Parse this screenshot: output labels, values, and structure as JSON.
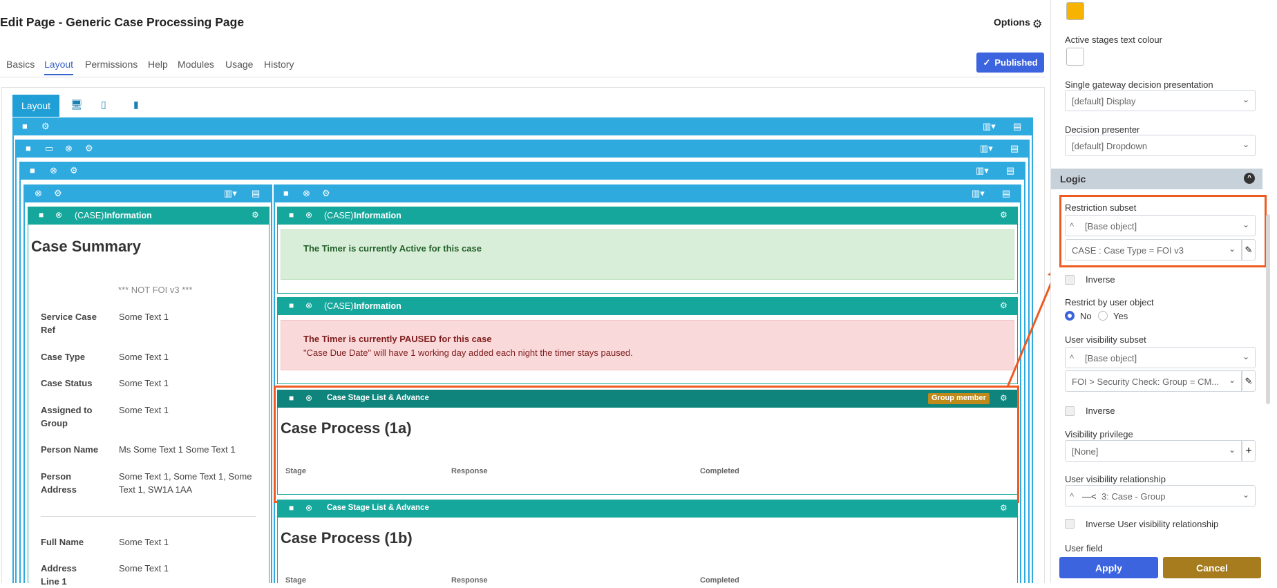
{
  "page": {
    "title": "Edit Page - Generic Case Processing Page",
    "options_label": "Options",
    "published_label": "Published"
  },
  "tabs": [
    "Basics",
    "Layout",
    "Permissions",
    "Help",
    "Modules",
    "Usage",
    "History"
  ],
  "active_tab": "Layout",
  "canvas": {
    "layout_tab": "Layout"
  },
  "widgets": {
    "info_label": "(CASE)",
    "info_title": "Information",
    "stage_title": "Case Stage List & Advance",
    "group_member_badge": "Group member"
  },
  "left_panel": {
    "heading": "Case Summary",
    "not_foi": "*** NOT FOI v3 ***",
    "rows": [
      {
        "label": "Service Case Ref",
        "value": "Some Text 1"
      },
      {
        "label": "Case Type",
        "value": "Some Text 1"
      },
      {
        "label": "Case Status",
        "value": "Some Text 1"
      },
      {
        "label": "Assigned to Group",
        "value": "Some Text 1"
      },
      {
        "label": "Person Name",
        "value": "Ms Some Text 1 Some Text 1"
      },
      {
        "label": "Person Address",
        "value": "Some Text 1, Some Text 1, Some Text 1, SW1A 1AA"
      },
      {
        "label": "Full Name",
        "value": "Some Text 1"
      },
      {
        "label": "Address Line 1",
        "value": "Some Text 1"
      }
    ]
  },
  "timer_active": "The Timer is currently Active for this case",
  "timer_paused": {
    "title": "The Timer is currently PAUSED for this case",
    "detail": "\"Case Due Date\" will have 1 working day added each night the timer stays paused."
  },
  "case_process_1a": {
    "heading": "Case Process (1a)",
    "columns": [
      "Stage",
      "Response",
      "Completed"
    ]
  },
  "case_process_1b": {
    "heading": "Case Process (1b)",
    "columns": [
      "Stage",
      "Response",
      "Completed"
    ]
  },
  "right_panel": {
    "active_stages_text_colour": "Active stages text colour",
    "single_gateway_label": "Single gateway decision presentation",
    "single_gateway_value": "[default] Display",
    "decision_presenter_label": "Decision presenter",
    "decision_presenter_value": "[default] Dropdown",
    "logic_header": "Logic",
    "restriction_subset_label": "Restriction subset",
    "restriction_subset_value": "[Base object]",
    "restriction_filter_value": "CASE : Case Type = FOI v3",
    "inverse_label": "Inverse",
    "restrict_by_user_label": "Restrict by user object",
    "radio_no": "No",
    "radio_yes": "Yes",
    "user_visibility_subset_label": "User visibility subset",
    "user_visibility_subset_value": "[Base object]",
    "user_visibility_filter_value": "FOI > Security Check: Group = CM...",
    "inverse2_label": "Inverse",
    "visibility_privilege_label": "Visibility privilege",
    "visibility_privilege_value": "[None]",
    "user_visibility_relationship_label": "User visibility relationship",
    "user_visibility_relationship_value": "3: Case - Group",
    "inverse_relationship_label": "Inverse User visibility relationship",
    "user_field_label": "User field",
    "apply_label": "Apply",
    "cancel_label": "Cancel"
  },
  "colors": {
    "accent_blue": "#2eaadf",
    "teal": "#15a79c",
    "highlight": "#ee5a1f",
    "swatch_yellow": "#f6b400"
  }
}
